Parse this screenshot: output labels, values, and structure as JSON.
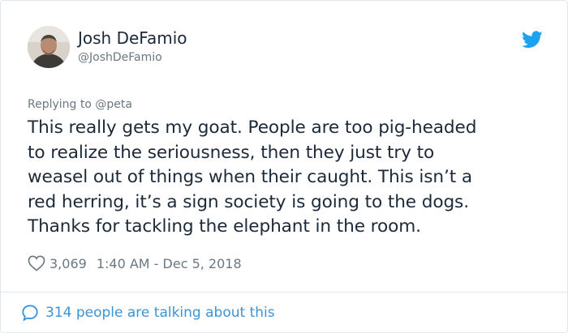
{
  "tweet": {
    "author": {
      "display_name": "Josh DeFamio",
      "handle": "@JoshDeFamio"
    },
    "replying_to": "Replying to @peta",
    "text_lines": [
      "This really gets my goat. People are too pig-headed",
      "to realize the seriousness, then they just try to",
      "weasel out of things when their caught. This isn’t a",
      "red herring, it’s a sign society is going to the dogs.",
      "Thanks for tackling the elephant in the room."
    ],
    "like_count": "3,069",
    "timestamp": "1:40 AM - Dec 5, 2018",
    "conversation_link": "314 people are talking about this"
  },
  "colors": {
    "text_primary": "#1c2938",
    "text_secondary": "#697882",
    "twitter_blue": "#1da1f2",
    "link_blue": "#3b94d9",
    "border": "#e1e8ed"
  },
  "icons": {
    "brand": "twitter-bird-icon",
    "like": "heart-outline-icon",
    "conversation": "speech-bubble-icon"
  }
}
